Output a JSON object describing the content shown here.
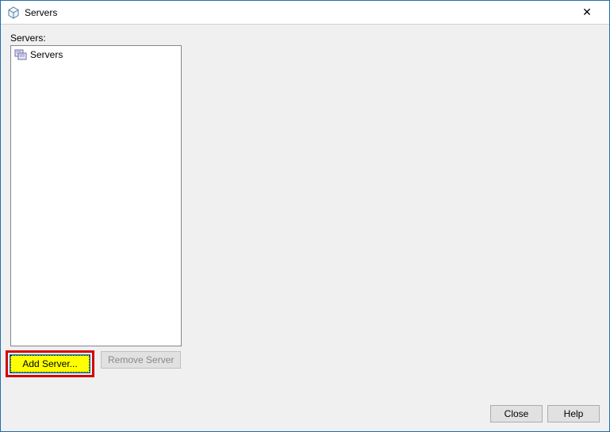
{
  "titlebar": {
    "title": "Servers",
    "close_symbol": "✕"
  },
  "content": {
    "label": "Servers:",
    "tree": {
      "root_label": "Servers"
    },
    "buttons": {
      "add_server": "Add Server...",
      "remove_server": "Remove Server"
    }
  },
  "footer": {
    "close": "Close",
    "help": "Help"
  }
}
